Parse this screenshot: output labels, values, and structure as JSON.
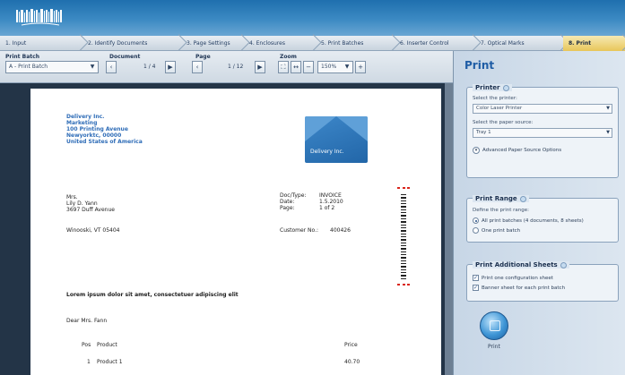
{
  "steps": [
    {
      "label": "1. Input",
      "active": false
    },
    {
      "label": "2. Identify Documents",
      "active": false
    },
    {
      "label": "3. Page Settings",
      "active": false
    },
    {
      "label": "4. Enclosures",
      "active": false
    },
    {
      "label": "5. Print Batches",
      "active": false
    },
    {
      "label": "6. Inserter Control",
      "active": false
    },
    {
      "label": "7. Optical Marks",
      "active": false
    },
    {
      "label": "8. Print",
      "active": true
    }
  ],
  "toolbar": {
    "print_batch_label": "Print Batch",
    "print_batch_value": "A - Print Batch",
    "document_label": "Document",
    "document_value": "1 / 4",
    "page_label": "Page",
    "page_value": "1 / 12",
    "zoom_label": "Zoom",
    "zoom_value": "150%"
  },
  "document": {
    "sender": [
      "Delivery Inc.",
      "Marketing",
      "100 Printing Avenue",
      "Newyorktc, 00000",
      "United States of America"
    ],
    "logo_text": "Delivery Inc.",
    "recipient": [
      "Mrs.",
      "Lily D. Yann",
      "3697 Duff Avenue"
    ],
    "recipient_city": "Winooski, VT 05404",
    "meta": [
      {
        "k": "Doc/Type:",
        "v": "INVOICE"
      },
      {
        "k": "Date:",
        "v": "1.5.2010"
      },
      {
        "k": "Page:",
        "v": "1 of 2"
      }
    ],
    "customer_no_label": "Customer No.:",
    "customer_no_value": "400426",
    "lorem": "Lorem ipsum dolor sit amet, consectetuer adipiscing elit",
    "greeting": "Dear Mrs. Fann",
    "table_headers": {
      "pos": "Pos",
      "product": "Product",
      "price": "Price"
    },
    "table_rows": [
      {
        "pos": "1",
        "product": "Product 1",
        "price": "40.70"
      }
    ]
  },
  "panel": {
    "title": "Print",
    "printer": {
      "heading": "Printer",
      "select_printer_label": "Select the printer:",
      "printer_value": "Color Laser Printer",
      "paper_source_label": "Select the paper source:",
      "paper_source_value": "Tray 1",
      "advanced_label": "Advanced Paper Source Options"
    },
    "range": {
      "heading": "Print Range",
      "define_label": "Define the print range:",
      "option_all": "All print batches (4 documents, 8 sheets)",
      "option_one": "One print batch"
    },
    "additional": {
      "heading": "Print Additional Sheets",
      "option_config": "Print one configuration sheet",
      "option_banner": "Banner sheet for each print batch"
    },
    "print_button_label": "Print"
  },
  "colors": {
    "header_blue": "#1f6fae",
    "active_step": "#e8c659",
    "title_blue": "#1f5da5",
    "doc_link_blue": "#2e6cb7",
    "barcode_red": "#d9261c"
  }
}
